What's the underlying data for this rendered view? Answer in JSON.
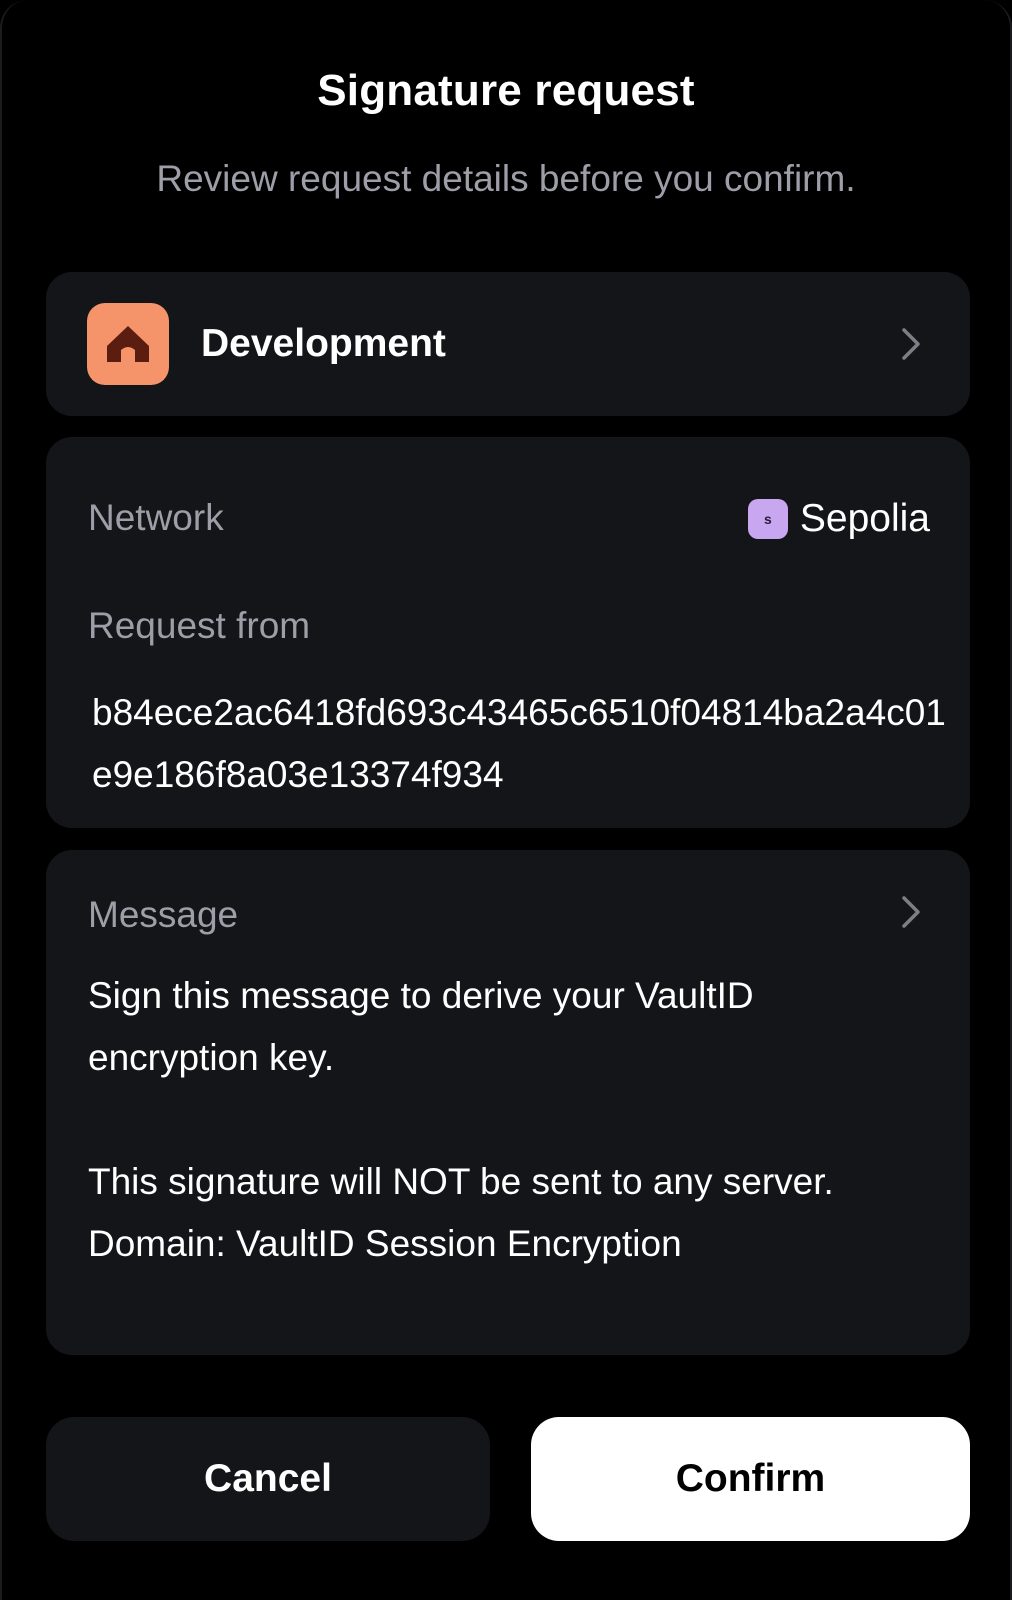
{
  "header": {
    "title": "Signature request",
    "subtitle": "Review request details before you confirm."
  },
  "account": {
    "name": "Development",
    "logo_color": "#f5936b",
    "logo_icon": "house-icon"
  },
  "details": {
    "network_label": "Network",
    "network_badge": "s",
    "network_name": "Sepolia",
    "network_badge_color": "#c9a6f0",
    "request_from_label": "Request from",
    "request_from_value": "b84ece2ac6418fd693c43465c6510f04814ba2a4c01e9e186f8a03e13374f934"
  },
  "message": {
    "label": "Message",
    "text": "Sign this message to derive your VaultID encryption key.\n\nThis signature will NOT be sent to any server.\nDomain: VaultID Session Encryption"
  },
  "actions": {
    "cancel_label": "Cancel",
    "confirm_label": "Confirm"
  }
}
